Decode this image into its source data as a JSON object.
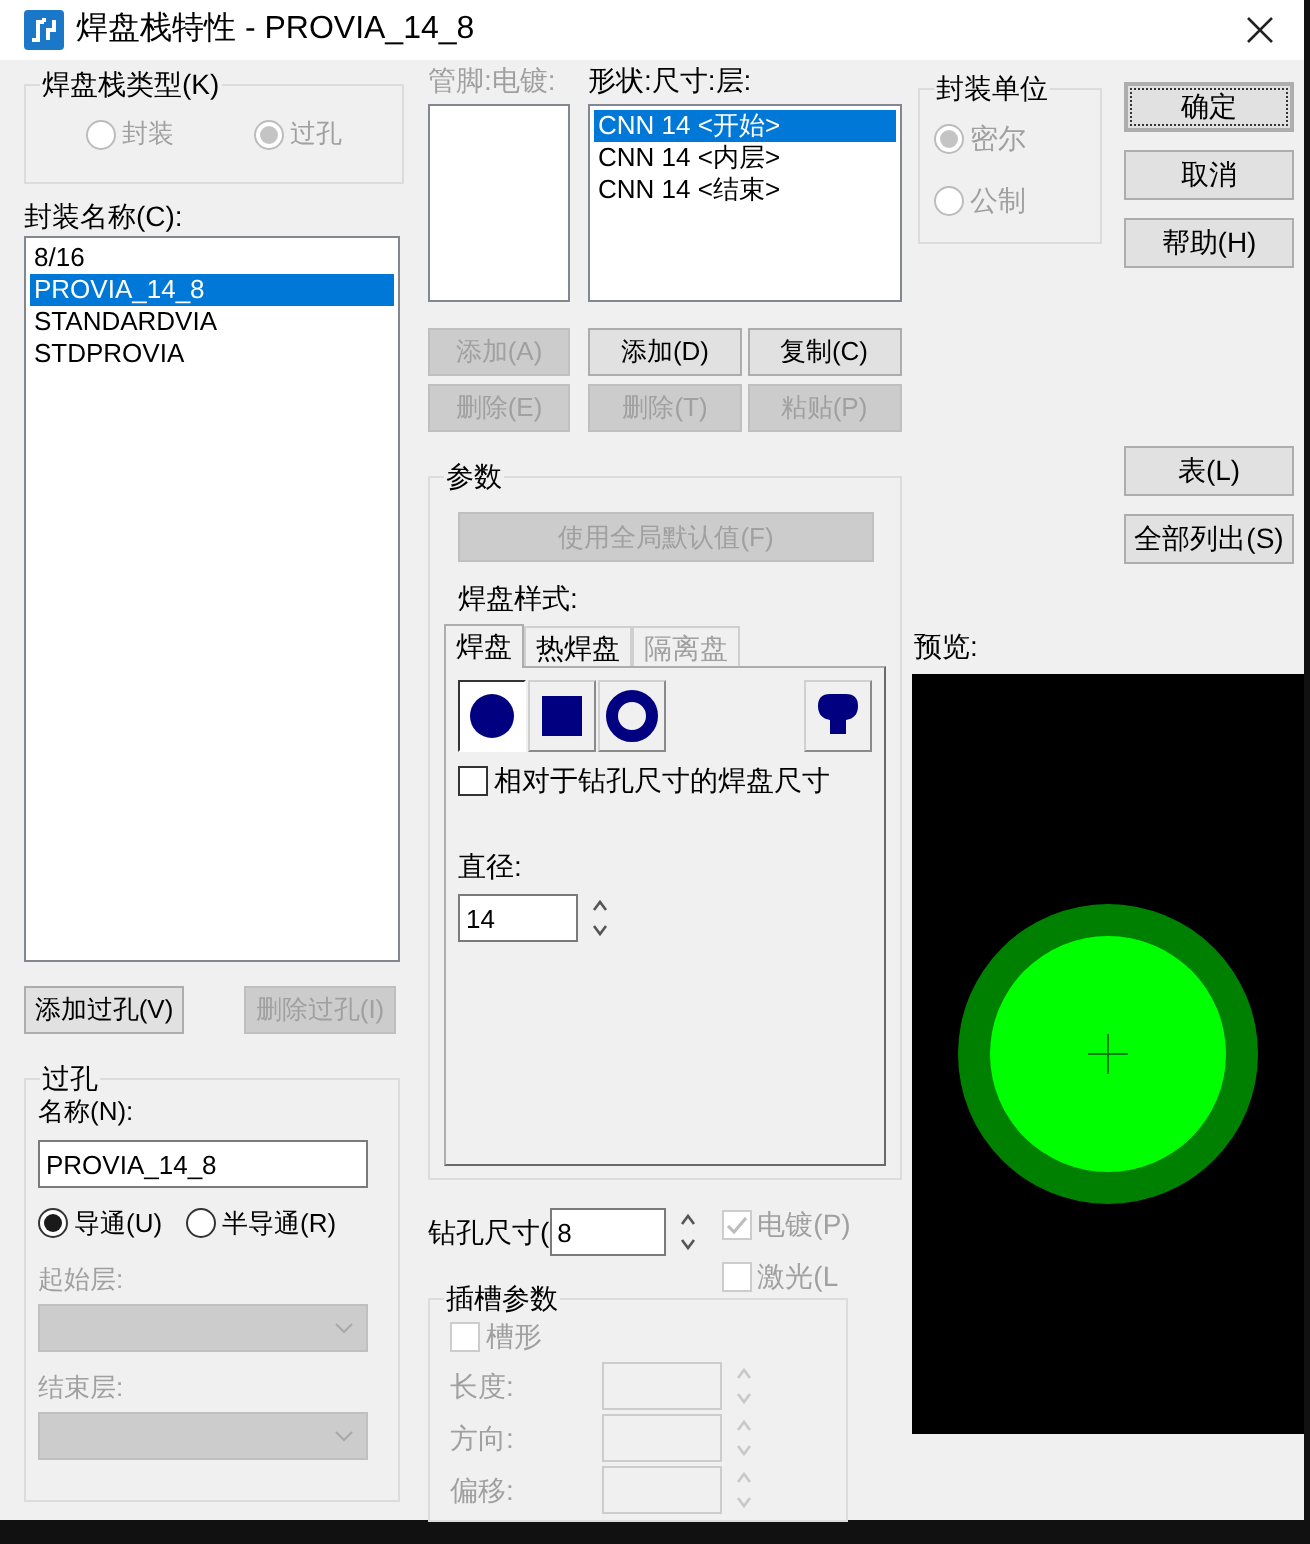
{
  "window": {
    "title": "焊盘栈特性 - PROVIA_14_8"
  },
  "padstack_type": {
    "title": "焊盘栈类型(K)",
    "disabled": true,
    "options": [
      {
        "label": "封装",
        "selected": false
      },
      {
        "label": "过孔",
        "selected": true
      }
    ]
  },
  "package_names": {
    "label": "封装名称(C):",
    "items": [
      {
        "text": "8/16",
        "selected": false
      },
      {
        "text": "PROVIA_14_8",
        "selected": true
      },
      {
        "text": "STANDARDVIA",
        "selected": false
      },
      {
        "text": "STDPROVIA",
        "selected": false
      }
    ]
  },
  "via_buttons": [
    {
      "label": "添加过孔(V)",
      "disabled": false
    },
    {
      "label": "删除过孔(I)",
      "disabled": true
    }
  ],
  "via": {
    "title": "过孔",
    "name_label": "名称(N):",
    "name_value": "PROVIA_14_8",
    "conduction": [
      {
        "label": "导通(U)",
        "selected": true
      },
      {
        "label": "半导通(R)",
        "selected": false
      }
    ],
    "layers": [
      {
        "label": "起始层:",
        "disabled": true
      },
      {
        "label": "结束层:",
        "disabled": true
      }
    ]
  },
  "pin_plating": {
    "label": "管脚:电镀:",
    "disabled": true
  },
  "shape_layers": {
    "label": "形状:尺寸:层:",
    "items": [
      {
        "text": "CNN 14 <开始>",
        "selected": true
      },
      {
        "text": "CNN 14 <内层>",
        "selected": false
      },
      {
        "text": "CNN 14 <结束>",
        "selected": false
      }
    ]
  },
  "pin_buttons": [
    {
      "label": "添加(A)",
      "disabled": true
    },
    {
      "label": "删除(E)",
      "disabled": true
    }
  ],
  "layer_buttons": [
    {
      "label": "添加(D)",
      "disabled": false
    },
    {
      "label": "复制(C)",
      "disabled": false
    },
    {
      "label": "删除(T)",
      "disabled": true
    },
    {
      "label": "粘贴(P)",
      "disabled": true
    }
  ],
  "params": {
    "title": "参数",
    "global_default": {
      "label": "使用全局默认值(F)",
      "disabled": true
    },
    "pad_style_label": "焊盘样式:",
    "tabs": [
      {
        "label": "焊盘",
        "selected": true,
        "disabled": false
      },
      {
        "label": "热焊盘",
        "selected": false,
        "disabled": false
      },
      {
        "label": "隔离盘",
        "selected": false,
        "disabled": true
      }
    ],
    "shapes": [
      {
        "kind": "circle",
        "selected": true
      },
      {
        "kind": "square",
        "selected": false
      },
      {
        "kind": "ring",
        "selected": false
      },
      {
        "kind": "custom",
        "selected": false
      }
    ],
    "relative_size": {
      "label": "相对于钻孔尺寸的焊盘尺寸",
      "checked": false
    },
    "diameter": {
      "label": "直径:",
      "value": "14"
    }
  },
  "drill": {
    "label": "钻孔尺寸(",
    "value": "8"
  },
  "drill_options": [
    {
      "label": "电镀(P)",
      "checked": true,
      "disabled": true
    },
    {
      "label": "激光(L",
      "checked": false,
      "disabled": true
    }
  ],
  "slot": {
    "title": "插槽参数",
    "disabled": true,
    "slotted": {
      "label": "槽形",
      "checked": false
    },
    "fields": [
      {
        "label": "长度:"
      },
      {
        "label": "方向:"
      },
      {
        "label": "偏移:"
      }
    ]
  },
  "units": {
    "title": "封装单位",
    "disabled": true,
    "options": [
      {
        "label": "密尔",
        "selected": true
      },
      {
        "label": "公制",
        "selected": false
      }
    ]
  },
  "dialog_buttons": [
    {
      "label": "确定",
      "default": true
    },
    {
      "label": "取消",
      "default": false
    },
    {
      "label": "帮助(H)",
      "default": false
    }
  ],
  "list_buttons": [
    {
      "label": "表(L)"
    },
    {
      "label": "全部列出(S)"
    }
  ],
  "preview": {
    "label": "预览:"
  }
}
